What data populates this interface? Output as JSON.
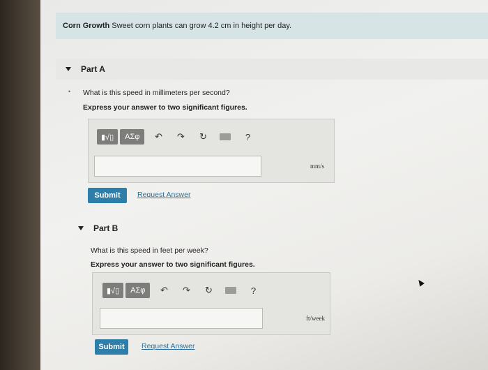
{
  "problem": {
    "title": "Corn Growth",
    "statement": "Sweet corn plants can grow 4.2 cm in height per day."
  },
  "part_a": {
    "label": "Part A",
    "question": "What is this speed in millimeters per second?",
    "instruction": "Express your answer to two significant figures.",
    "unit": "mm/s",
    "answer_value": "",
    "submit_label": "Submit",
    "request_label": "Request Answer"
  },
  "part_b": {
    "label": "Part B",
    "question": "What is this speed in feet per week?",
    "instruction": "Express your answer to two significant figures.",
    "unit": "ft/week",
    "answer_value": "",
    "submit_label": "Submit",
    "request_label": "Request Answer"
  },
  "toolbar": {
    "symbols_label": "ΑΣφ",
    "help_label": "?",
    "template_glyph": "▮√▯",
    "undo_glyph": "↶",
    "redo_glyph": "↷",
    "reset_glyph": "↻"
  },
  "colors": {
    "header_bg": "#d6e4e6",
    "submit_bg": "#2d7ea8",
    "link": "#2d6f98",
    "tool_button_bg": "#7d7d7b"
  }
}
